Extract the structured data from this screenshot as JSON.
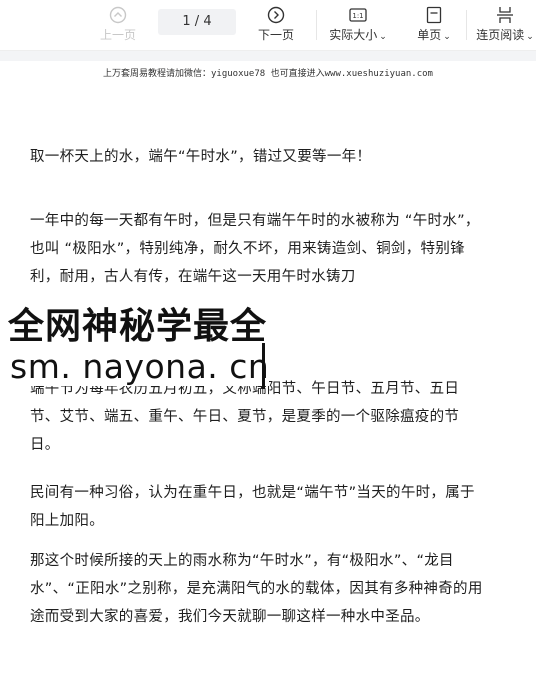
{
  "toolbar": {
    "prev_label": "上一页",
    "page_indicator": "1 / 4",
    "next_label": "下一页",
    "actual_size_label": "实际大小",
    "actual_size_icon_text": "1:1",
    "single_page_label": "单页",
    "continuous_label": "连页阅读",
    "icons": [
      "chevron-up-circle-icon",
      "chevron-right-circle-icon",
      "actual-size-icon",
      "single-page-icon",
      "continuous-page-icon",
      "caret-down-icon"
    ]
  },
  "document": {
    "notice": "上万套周易教程请加微信：yiguoxue78  也可直接进入www.xueshuziyuan.com",
    "paragraphs": [
      "取一杯天上的水，端午“午时水”，错过又要等一年！",
      "一年中的每一天都有午时，但是只有端午午时的水被称为 “午时水”，也叫 “极阳水”，特别纯净，耐久不坏，用来铸造剑、铜剑，特别锋利，耐用，古人有传，在端午这一天用午时水铸刀",
      "端午节为每年农历五月初五，又称端阳节、午日节、五月节、五日节、艾节、端五、重午、午日、夏节，是夏季的一个驱除瘟疫的节日。",
      "民间有一种习俗，认为在重午日，也就是“端午节”当天的午时，属于阳上加阳。",
      "那这个时候所接的天上的雨水称为“午时水”，有“极阳水”、“龙目水”、“正阳水”之别称，是充满阳气的水的载体，因其有多种神奇的用途而受到大家的喜爱，我们今天就聊一聊这样一种水中圣品。"
    ],
    "watermark_line1": "全网神秘学最全",
    "watermark_line2": "sm. nayona. cn"
  }
}
